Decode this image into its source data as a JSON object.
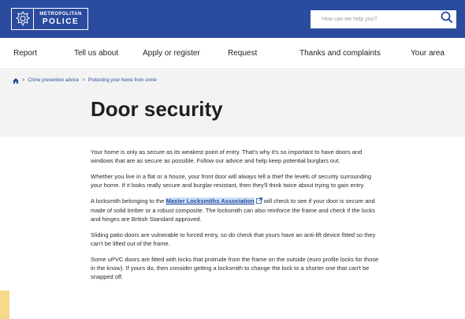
{
  "header": {
    "logo_top": "METROPOLITAN",
    "logo_bottom": "POLICE",
    "search_placeholder": "How can we help you?",
    "brand_color": "#2b4b9e",
    "search_icon": "search-icon"
  },
  "nav": {
    "items": [
      {
        "label": "Report"
      },
      {
        "label": "Tell us about"
      },
      {
        "label": "Apply or register"
      },
      {
        "label": "Request"
      },
      {
        "label": "Thanks and complaints"
      },
      {
        "label": "Your area"
      }
    ]
  },
  "breadcrumb": {
    "home_icon": "home-icon",
    "items": [
      "Crime prevention advice",
      "Protecting your home from crime"
    ],
    "separator": ">"
  },
  "page": {
    "title": "Door security"
  },
  "content": {
    "p1": "Your home is only as secure as its weakest point of entry. That's why it's so important to have doors and windows that are as secure as possible. Follow our advice and help keep potential burglars out.",
    "p2": "Whether you live in a flat or a house, your front door will always tell a thief the levels of security surrounding your home. If it looks really secure and burglar-resistant, then they'll think twice about trying to gain entry.",
    "p3_before": "A locksmith belonging to the ",
    "p3_link": "Master Locksmiths Association",
    "p3_after": "will check to see if your door is secure and made of solid timber or a robust composite. The locksmith can also reinforce the frame and check if the locks and hinges are British Standard approved.",
    "p4": "Sliding patio doors are vulnerable to forced entry, so do check that yours have an anti-lift device fitted so they can't be lifted out of the frame.",
    "p5": "Some uPVC doors are fitted with locks that protrude from the frame on the outside (euro profile locks for those in the know). If yours do, then consider getting a locksmith to change the lock to a shorter one that can't be snapped off.",
    "external_link_icon": "external-link-icon"
  }
}
